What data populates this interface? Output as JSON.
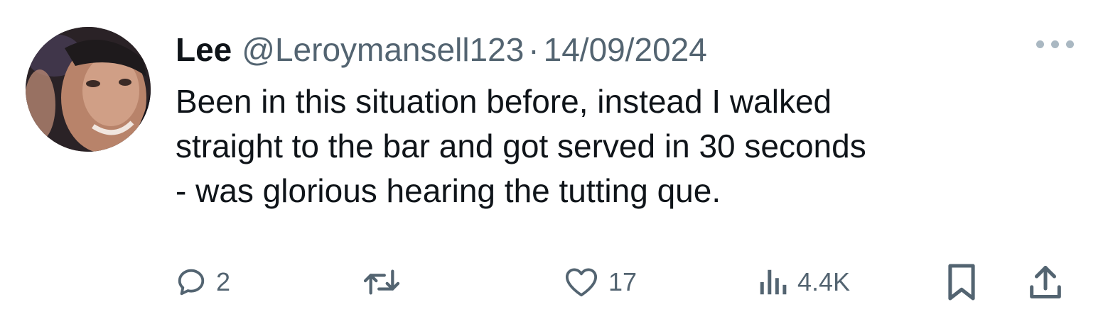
{
  "tweet": {
    "author_name": "Lee",
    "handle": "@Leroymansell123",
    "separator": "·",
    "date": "14/09/2024",
    "text_lines": [
      "Been in this situation before, instead I walked",
      "straight to the bar and got served in 30 seconds",
      "- was glorious hearing the tutting que."
    ]
  },
  "actions": {
    "reply_count": "2",
    "like_count": "17",
    "views_count": "4.4K"
  },
  "icons": {
    "reply": "speech-bubble-icon",
    "retweet": "retweet-arrows-icon",
    "like": "heart-icon",
    "views": "bar-chart-icon",
    "bookmark": "bookmark-icon",
    "share": "upload-arrow-icon",
    "more": "ellipsis-icon"
  }
}
